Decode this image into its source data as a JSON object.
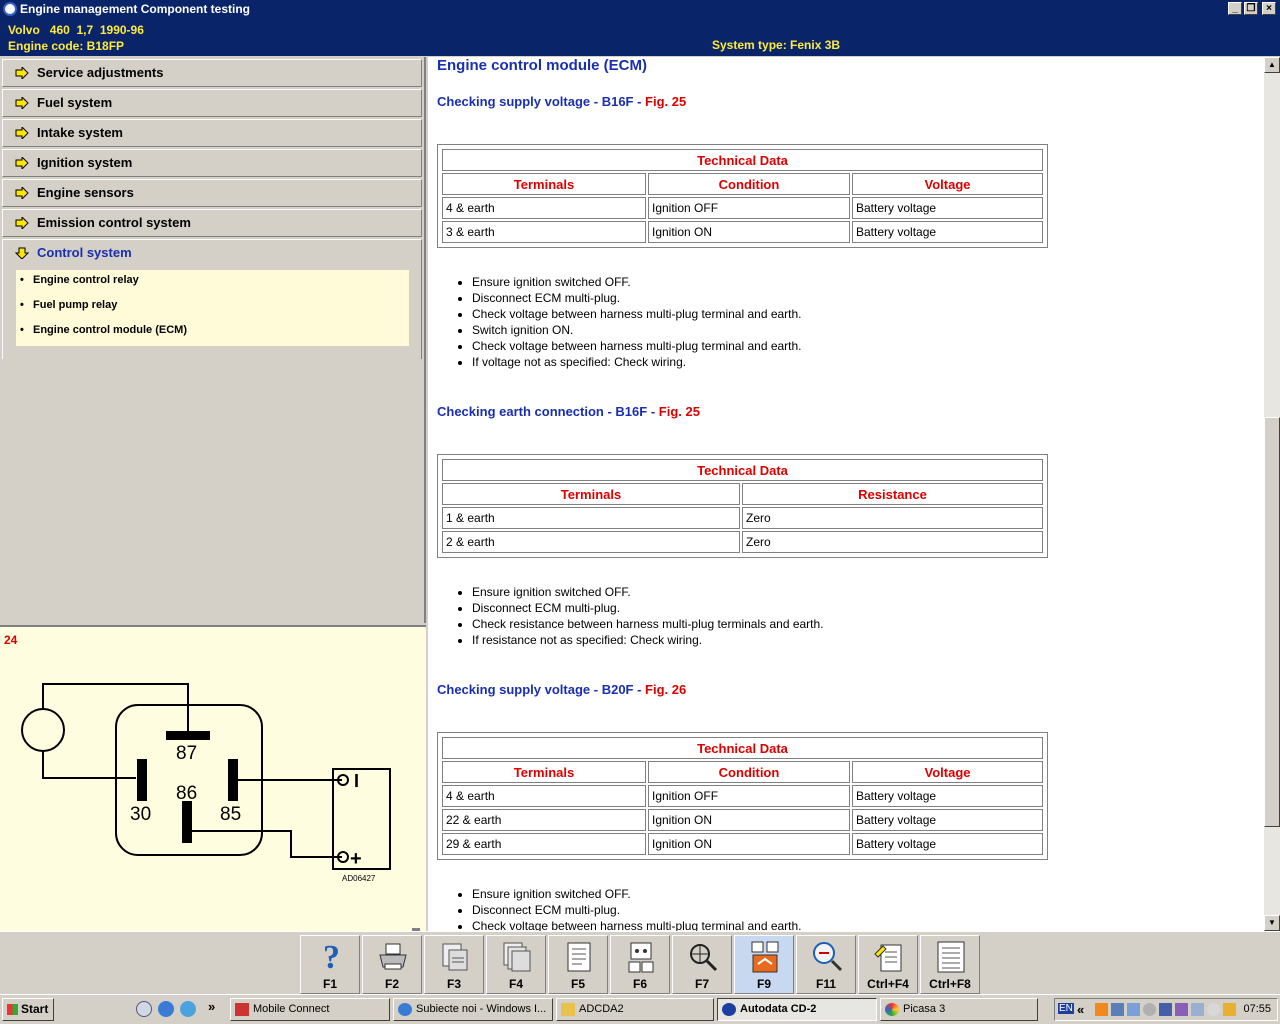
{
  "window": {
    "title": "Engine management Component testing",
    "buttons": [
      "_",
      "❐",
      "×"
    ]
  },
  "vehicle": {
    "make": "Volvo",
    "model": "460",
    "engine_size": "1,7",
    "years": "1990-96",
    "engine_code_label": "Engine code: B18FP",
    "system_type_label": "System type: Fenix 3B"
  },
  "menu": {
    "items": [
      {
        "label": "Service adjustments"
      },
      {
        "label": "Fuel system"
      },
      {
        "label": "Intake system"
      },
      {
        "label": "Ignition system"
      },
      {
        "label": "Engine sensors"
      },
      {
        "label": "Emission control system"
      },
      {
        "label": "Control system",
        "active": true
      }
    ],
    "subitems": [
      {
        "label": "Engine control relay"
      },
      {
        "label": "Fuel pump relay"
      },
      {
        "label": "Engine control module (ECM)"
      }
    ]
  },
  "figure": {
    "number": "24",
    "pin_87": "87",
    "pin_30": "30",
    "pin_86": "86",
    "pin_85": "85",
    "terminal_i": "I",
    "terminal_plus": "+",
    "code": "AD06427"
  },
  "content": {
    "heading": "Engine control module (ECM)",
    "sections": [
      {
        "title": "Checking supply voltage - B16F - ",
        "fig": "Fig. 25",
        "table_title": "Technical Data",
        "headers": [
          "Terminals",
          "Condition",
          "Voltage"
        ],
        "rows": [
          [
            "4 & earth",
            "Ignition OFF",
            "Battery voltage"
          ],
          [
            "3 & earth",
            "Ignition ON",
            "Battery voltage"
          ]
        ],
        "steps": [
          "Ensure ignition switched OFF.",
          "Disconnect ECM multi-plug.",
          "Check voltage between harness multi-plug terminal and earth.",
          "Switch ignition ON.",
          "Check voltage between harness multi-plug terminal and earth.",
          "If voltage not as specified: Check wiring."
        ]
      },
      {
        "title": "Checking earth connection - B16F - ",
        "fig": "Fig. 25",
        "table_title": "Technical Data",
        "headers": [
          "Terminals",
          "Resistance"
        ],
        "rows": [
          [
            "1 & earth",
            "Zero"
          ],
          [
            "2 & earth",
            "Zero"
          ]
        ],
        "steps": [
          "Ensure ignition switched OFF.",
          "Disconnect ECM multi-plug.",
          "Check resistance between harness multi-plug terminals and earth.",
          "If resistance not as specified: Check wiring."
        ]
      },
      {
        "title": "Checking supply voltage - B20F - ",
        "fig": "Fig. 26",
        "table_title": "Technical Data",
        "headers": [
          "Terminals",
          "Condition",
          "Voltage"
        ],
        "rows": [
          [
            "4 & earth",
            "Ignition OFF",
            "Battery voltage"
          ],
          [
            "22 & earth",
            "Ignition ON",
            "Battery voltage"
          ],
          [
            "29 & earth",
            "Ignition ON",
            "Battery voltage"
          ]
        ],
        "steps": [
          "Ensure ignition switched OFF.",
          "Disconnect ECM multi-plug.",
          "Check voltage between harness multi-plug terminal and earth."
        ]
      }
    ]
  },
  "fkeys": [
    {
      "label": "F1",
      "icon": "help-icon"
    },
    {
      "label": "F2",
      "icon": "printer-icon"
    },
    {
      "label": "F3",
      "icon": "print-page-icon"
    },
    {
      "label": "F4",
      "icon": "print-all-icon"
    },
    {
      "label": "F5",
      "icon": "document-icon"
    },
    {
      "label": "F6",
      "icon": "connector-icon"
    },
    {
      "label": "F7",
      "icon": "search-component-icon"
    },
    {
      "label": "F9",
      "icon": "diagram-icon"
    },
    {
      "label": "F11",
      "icon": "magnifier-icon"
    },
    {
      "label": "Ctrl+F4",
      "icon": "notes-icon"
    },
    {
      "label": "Ctrl+F8",
      "icon": "list-icon"
    }
  ],
  "taskbar": {
    "start": "Start",
    "quicklaunch_more": "»",
    "tasks": [
      {
        "label": "Mobile Connect"
      },
      {
        "label": "Subiecte noi - Windows I..."
      },
      {
        "label": "ADCDA2"
      },
      {
        "label": "Autodata CD-2",
        "active": true
      },
      {
        "label": "Picasa 3"
      }
    ],
    "lang": "EN",
    "tray_more": "«",
    "clock": "07:55"
  }
}
